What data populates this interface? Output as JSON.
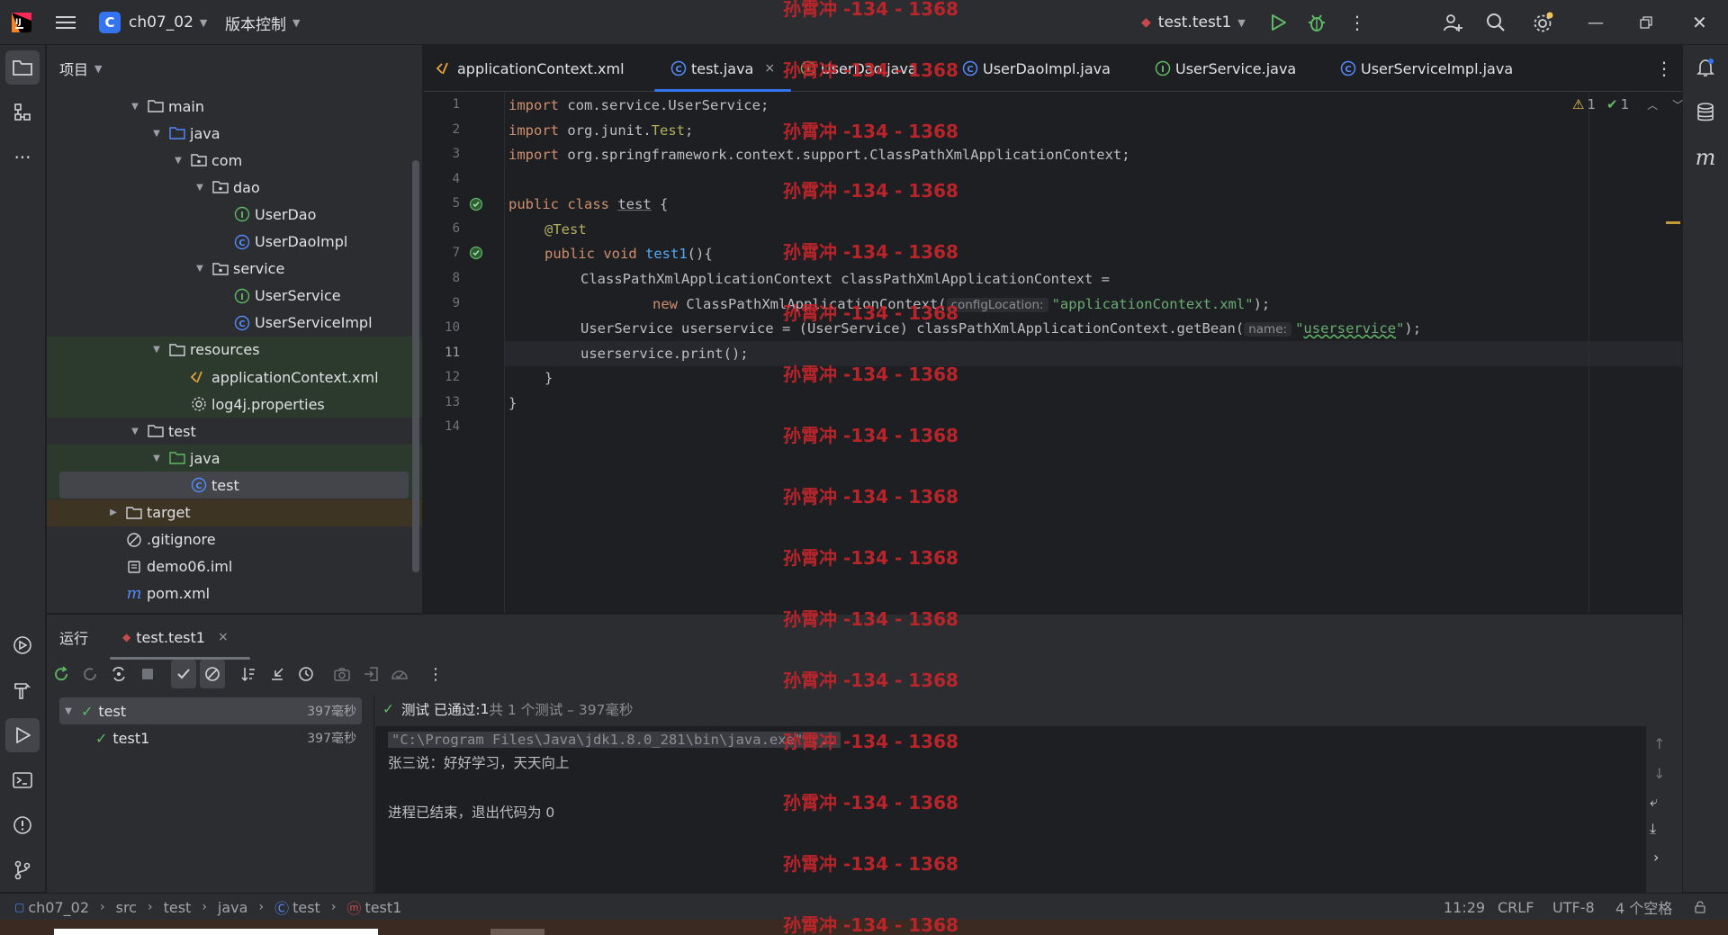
{
  "titlebar": {
    "project_initial": "C",
    "project_name": "ch07_02",
    "vcs_label": "版本控制",
    "run_config": "test.test1"
  },
  "project_panel": {
    "header": "项目",
    "tree": [
      {
        "label": "main",
        "kind": "folder",
        "indent": 1,
        "expanded": true
      },
      {
        "label": "java",
        "kind": "src-folder",
        "indent": 2,
        "expanded": true
      },
      {
        "label": "com",
        "kind": "package",
        "indent": 3,
        "expanded": true
      },
      {
        "label": "dao",
        "kind": "package",
        "indent": 4,
        "expanded": true
      },
      {
        "label": "UserDao",
        "kind": "interface",
        "indent": 5
      },
      {
        "label": "UserDaoImpl",
        "kind": "class",
        "indent": 5
      },
      {
        "label": "service",
        "kind": "package",
        "indent": 4,
        "expanded": true
      },
      {
        "label": "UserService",
        "kind": "interface",
        "indent": 5
      },
      {
        "label": "UserServiceImpl",
        "kind": "class",
        "indent": 5
      },
      {
        "label": "resources",
        "kind": "folder",
        "indent": 2,
        "expanded": true
      },
      {
        "label": "applicationContext.xml",
        "kind": "xml",
        "indent": 3
      },
      {
        "label": "log4j.properties",
        "kind": "properties",
        "indent": 3
      },
      {
        "label": "test",
        "kind": "folder",
        "indent": 1,
        "expanded": true
      },
      {
        "label": "java",
        "kind": "test-folder",
        "indent": 2,
        "expanded": true
      },
      {
        "label": "test",
        "kind": "class",
        "indent": 3
      },
      {
        "label": "target",
        "kind": "folder",
        "indent": 0,
        "expanded": false
      },
      {
        "label": ".gitignore",
        "kind": "ignore",
        "indent": 0
      },
      {
        "label": "demo06.iml",
        "kind": "iml",
        "indent": 0
      },
      {
        "label": "pom.xml",
        "kind": "maven",
        "indent": 0
      }
    ]
  },
  "editor_tabs": [
    {
      "label": "applicationContext.xml",
      "icon": "xml-icon"
    },
    {
      "label": "test.java",
      "icon": "class-icon",
      "active": true,
      "close": "×"
    },
    {
      "label": "UserDao.java",
      "icon": "interface-icon"
    },
    {
      "label": "UserDaoImpl.java",
      "icon": "class-icon"
    },
    {
      "label": "UserService.java",
      "icon": "interface-icon"
    },
    {
      "label": "UserServiceImpl.java",
      "icon": "class-icon"
    }
  ],
  "inspections": {
    "warnings": "1",
    "weak_warnings": "1"
  },
  "code": {
    "line_numbers": [
      "1",
      "2",
      "3",
      "4",
      "5",
      "6",
      "7",
      "8",
      "9",
      "10",
      "11",
      "12",
      "13",
      "14"
    ],
    "l1_kw": "import",
    "l1_rest": " com.service.UserService;",
    "l2_kw": "import",
    "l2_a": " org.junit.",
    "l2_b": "Test",
    "l2_c": ";",
    "l3_kw": "import",
    "l3_rest": " org.springframework.context.support.ClassPathXmlApplicationContext;",
    "l5_kw": "public class",
    "l5_sp": " ",
    "l5_cls": "test",
    "l5_rest": " {",
    "l6_ann": "@Test",
    "l7_kw": "public void",
    "l7_sp": " ",
    "l7_fn": "test1",
    "l7_rest": "(){",
    "l8": "ClassPathXmlApplicationContext classPathXmlApplicationContext =",
    "l9_kw": "new",
    "l9_a": " ClassPathXmlApplicationContext(",
    "l9_hint": "configLocation:",
    "l9_str": "\"applicationContext.xml\"",
    "l9_end": ");",
    "l10_a": "UserService userservice = (UserService) classPathXmlApplicationContext.getBean(",
    "l10_hint": "name:",
    "l10_q1": "\"",
    "l10_str": "userservice",
    "l10_q2": "\"",
    "l10_end": ");",
    "l11": "userservice.print();",
    "l12": "}",
    "l13": "}"
  },
  "run_panel": {
    "tab_run": "运行",
    "tab_config": "test.test1",
    "tab_close": "×",
    "tree": [
      {
        "label": "test",
        "time": "397毫秒"
      },
      {
        "label": "test1",
        "time": "397毫秒"
      }
    ],
    "status_prefix": "测试 已通过: ",
    "status_count": "1",
    "status_suffix": "共 1 个测试 – 397毫秒",
    "console": [
      "\"C:\\Program Files\\Java\\jdk1.8.0_281\\bin\\java.exe\" ...",
      "张三说：好好学习，天天向上",
      "进程已结束，退出代码为 0"
    ]
  },
  "statusbar": {
    "breadcrumb": [
      "ch07_02",
      "src",
      "test",
      "java",
      "test",
      "test1"
    ],
    "position": "11:29",
    "line_sep": "CRLF",
    "encoding": "UTF-8",
    "indent": "4 个空格"
  },
  "watermark": "孙霄冲 -134 - 1368",
  "colors": {
    "accent": "#3574f0",
    "success": "#5fb865",
    "warning": "#f2c55c",
    "watermark": "#c8252b"
  }
}
